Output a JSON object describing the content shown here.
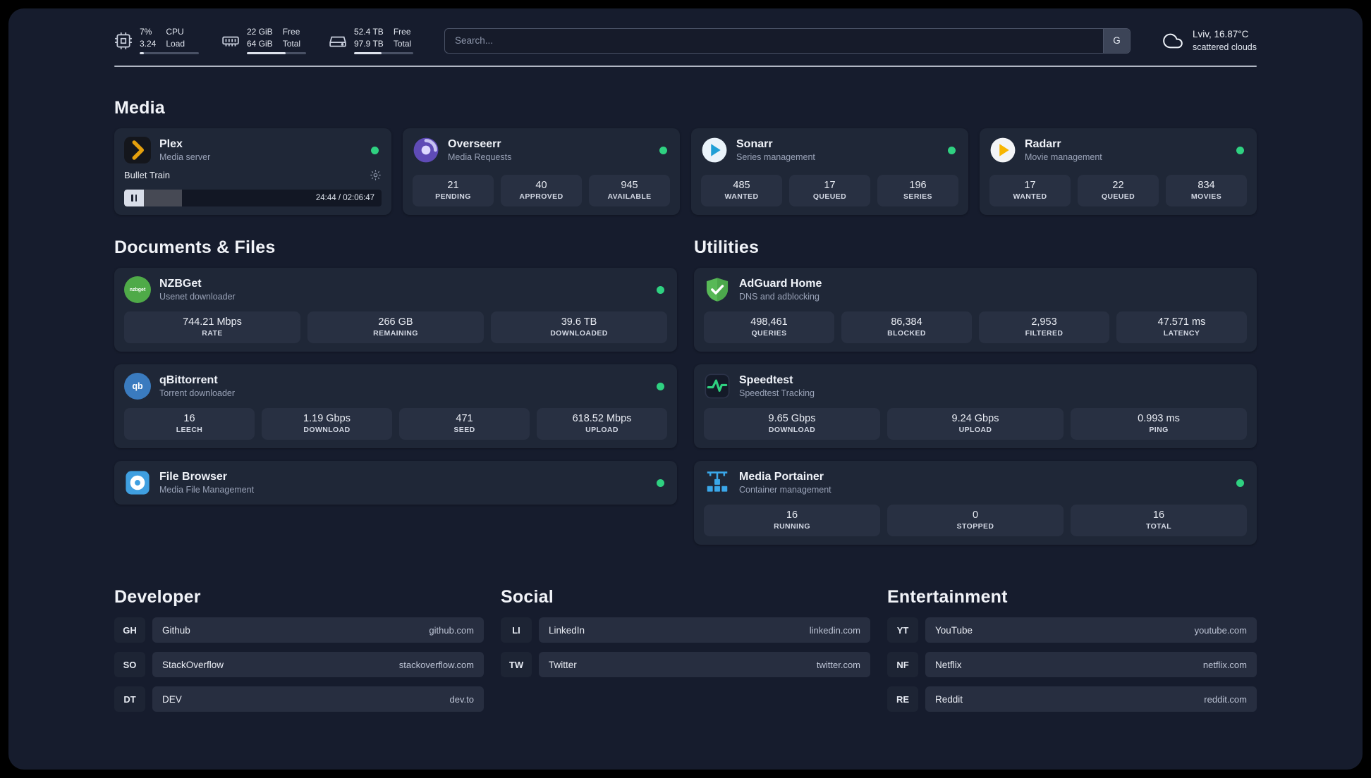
{
  "topbar": {
    "cpu": {
      "values": [
        "7%",
        "3.24"
      ],
      "labels": [
        "CPU",
        "Load"
      ],
      "progress_pct": 7
    },
    "memory": {
      "values": [
        "22 GiB",
        "64 GiB"
      ],
      "labels": [
        "Free",
        "Total"
      ],
      "progress_pct": 66
    },
    "disk": {
      "values": [
        "52.4 TB",
        "97.9 TB"
      ],
      "labels": [
        "Free",
        "Total"
      ],
      "progress_pct": 47
    },
    "search": {
      "placeholder": "Search...",
      "key_hint": "G"
    },
    "weather": {
      "location": "Lviv, 16.87°C",
      "condition": "scattered clouds"
    }
  },
  "media_section": {
    "title": "Media",
    "apps": [
      {
        "key": "plex",
        "icon": "plex-icon",
        "name": "Plex",
        "desc": "Media server",
        "online": true,
        "player": {
          "track": "Bullet Train",
          "time": "24:44 / 02:06:47",
          "progress_pct": 16
        }
      },
      {
        "key": "overseerr",
        "icon": "overseerr-icon",
        "name": "Overseerr",
        "desc": "Media Requests",
        "online": true,
        "stats": [
          {
            "value": "21",
            "label": "PENDING"
          },
          {
            "value": "40",
            "label": "APPROVED"
          },
          {
            "value": "945",
            "label": "AVAILABLE"
          }
        ]
      },
      {
        "key": "sonarr",
        "icon": "sonarr-icon",
        "name": "Sonarr",
        "desc": "Series management",
        "online": true,
        "stats": [
          {
            "value": "485",
            "label": "WANTED"
          },
          {
            "value": "17",
            "label": "QUEUED"
          },
          {
            "value": "196",
            "label": "SERIES"
          }
        ]
      },
      {
        "key": "radarr",
        "icon": "radarr-icon",
        "name": "Radarr",
        "desc": "Movie management",
        "online": true,
        "stats": [
          {
            "value": "17",
            "label": "WANTED"
          },
          {
            "value": "22",
            "label": "QUEUED"
          },
          {
            "value": "834",
            "label": "MOVIES"
          }
        ]
      }
    ]
  },
  "left_section": {
    "title": "Documents & Files",
    "apps": [
      {
        "key": "nzbget",
        "icon": "nzbget-icon",
        "name": "NZBGet",
        "desc": "Usenet downloader",
        "online": true,
        "stats": [
          {
            "value": "744.21 Mbps",
            "label": "RATE"
          },
          {
            "value": "266 GB",
            "label": "REMAINING"
          },
          {
            "value": "39.6 TB",
            "label": "DOWNLOADED"
          }
        ]
      },
      {
        "key": "qbittorrent",
        "icon": "qbittorrent-icon",
        "name": "qBittorrent",
        "desc": "Torrent downloader",
        "online": true,
        "stats": [
          {
            "value": "16",
            "label": "LEECH"
          },
          {
            "value": "1.19 Gbps",
            "label": "DOWNLOAD"
          },
          {
            "value": "471",
            "label": "SEED"
          },
          {
            "value": "618.52 Mbps",
            "label": "UPLOAD"
          }
        ]
      },
      {
        "key": "filebrowser",
        "icon": "filebrowser-icon",
        "name": "File Browser",
        "desc": "Media File Management",
        "online": true
      }
    ]
  },
  "right_section": {
    "title": "Utilities",
    "apps": [
      {
        "key": "adguard",
        "icon": "adguard-icon",
        "name": "AdGuard Home",
        "desc": "DNS and adblocking",
        "online": false,
        "stats": [
          {
            "value": "498,461",
            "label": "QUERIES"
          },
          {
            "value": "86,384",
            "label": "BLOCKED"
          },
          {
            "value": "2,953",
            "label": "FILTERED"
          },
          {
            "value": "47.571 ms",
            "label": "LATENCY"
          }
        ]
      },
      {
        "key": "speedtest",
        "icon": "speedtest-icon",
        "name": "Speedtest",
        "desc": "Speedtest Tracking",
        "online": false,
        "stats": [
          {
            "value": "9.65 Gbps",
            "label": "DOWNLOAD"
          },
          {
            "value": "9.24 Gbps",
            "label": "UPLOAD"
          },
          {
            "value": "0.993 ms",
            "label": "PING"
          }
        ]
      },
      {
        "key": "portainer",
        "icon": "portainer-icon",
        "name": "Media Portainer",
        "desc": "Container management",
        "online": true,
        "stats": [
          {
            "value": "16",
            "label": "RUNNING"
          },
          {
            "value": "0",
            "label": "STOPPED"
          },
          {
            "value": "16",
            "label": "TOTAL"
          }
        ]
      }
    ]
  },
  "bookmark_sections": [
    {
      "title": "Developer",
      "links": [
        {
          "abbr": "GH",
          "name": "Github",
          "url": "github.com"
        },
        {
          "abbr": "SO",
          "name": "StackOverflow",
          "url": "stackoverflow.com"
        },
        {
          "abbr": "DT",
          "name": "DEV",
          "url": "dev.to"
        }
      ]
    },
    {
      "title": "Social",
      "links": [
        {
          "abbr": "LI",
          "name": "LinkedIn",
          "url": "linkedin.com"
        },
        {
          "abbr": "TW",
          "name": "Twitter",
          "url": "twitter.com"
        }
      ]
    },
    {
      "title": "Entertainment",
      "links": [
        {
          "abbr": "YT",
          "name": "YouTube",
          "url": "youtube.com"
        },
        {
          "abbr": "NF",
          "name": "Netflix",
          "url": "netflix.com"
        },
        {
          "abbr": "RE",
          "name": "Reddit",
          "url": "reddit.com"
        }
      ]
    }
  ],
  "colors": {
    "status_online": "#2fd181",
    "accent_amber": "#e5a00d"
  }
}
